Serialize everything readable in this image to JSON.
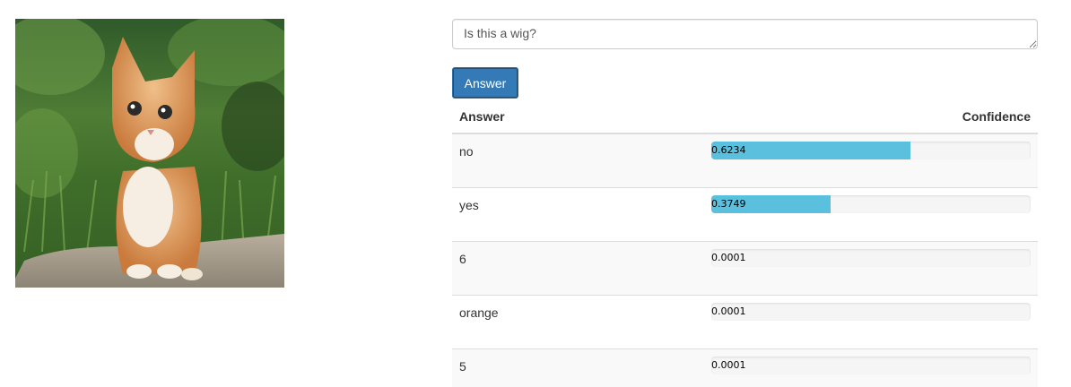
{
  "question": {
    "value": "Is this a wig?"
  },
  "button": {
    "label": "Answer"
  },
  "table": {
    "headers": {
      "answer": "Answer",
      "confidence": "Confidence"
    },
    "rows": [
      {
        "answer": "no",
        "confidence": "0.6234",
        "fraction": 0.6234
      },
      {
        "answer": "yes",
        "confidence": "0.3749",
        "fraction": 0.3749
      },
      {
        "answer": "6",
        "confidence": "0.0001",
        "fraction": 0.0001
      },
      {
        "answer": "orange",
        "confidence": "0.0001",
        "fraction": 0.0001
      },
      {
        "answer": "5",
        "confidence": "0.0001",
        "fraction": 0.0001
      }
    ]
  },
  "colors": {
    "primary": "#337ab7",
    "bar": "#5bc0de"
  }
}
